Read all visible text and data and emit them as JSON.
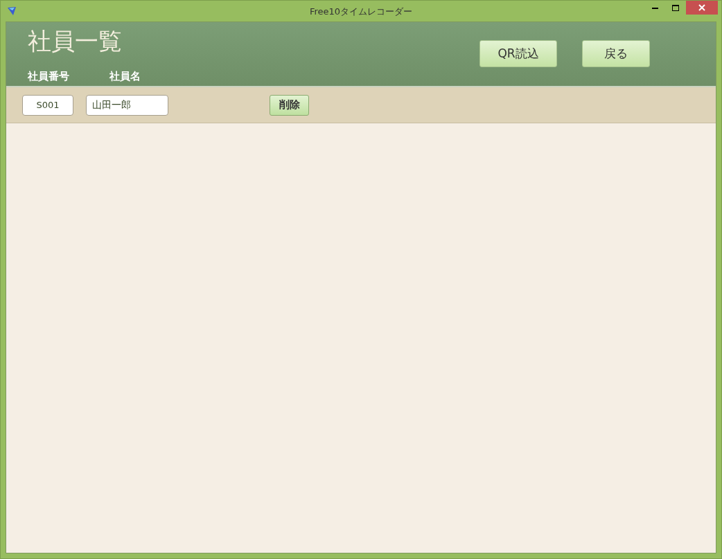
{
  "window": {
    "title": "Free10タイムレコーダー"
  },
  "header": {
    "title": "社員一覧",
    "columns": [
      "社員番号",
      "社員名"
    ],
    "buttons": [
      "QR読込",
      "戻る"
    ]
  },
  "rows": [
    {
      "employee_id": "S001",
      "employee_name": "山田一郎",
      "delete_button": "削除"
    }
  ]
}
